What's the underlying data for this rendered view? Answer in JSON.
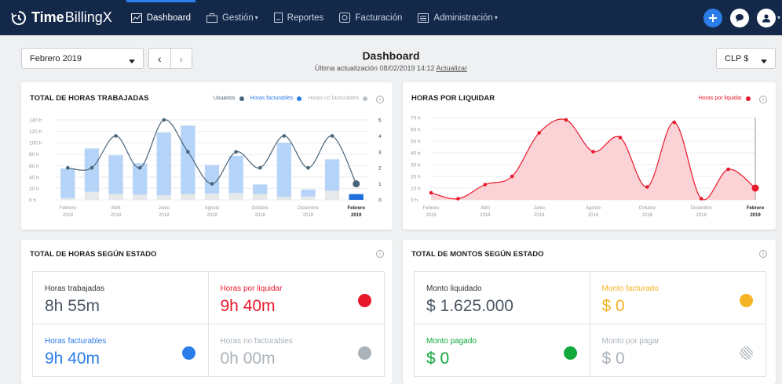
{
  "nav": {
    "brand_bold": "Time",
    "brand_rest": "BillingX",
    "items": [
      {
        "label": "Dashboard"
      },
      {
        "label": "Gestión",
        "caret": "▾"
      },
      {
        "label": "Reportes"
      },
      {
        "label": "Facturación"
      },
      {
        "label": "Administración",
        "caret": "▾"
      }
    ]
  },
  "toolbar": {
    "period": "Febrero 2019",
    "prev": "‹",
    "next": "›",
    "currency": "CLP $",
    "title": "Dashboard",
    "subtitle_prefix": "Última actualización 08/02/2019 14:12",
    "refresh": "Actualizar"
  },
  "card1": {
    "title": "TOTAL DE HORAS TRABAJADAS",
    "legend": [
      {
        "label": "Usuarios",
        "color": "#4a6578"
      },
      {
        "label": "Horas facturables",
        "color": "#2b7de9"
      },
      {
        "label": "Horas no facturables",
        "color": "#bcc3c9"
      }
    ]
  },
  "card2": {
    "title": "HORAS POR LIQUIDAR",
    "legend": [
      {
        "label": "Horas por liquidar",
        "color": "#e8192c"
      }
    ]
  },
  "card3": {
    "title": "TOTAL DE HORAS SEGÚN ESTADO",
    "cells": [
      {
        "label": "Horas trabajadas",
        "value": "8h 55m",
        "label_color": "#333",
        "value_color": "#4a5563",
        "dot": ""
      },
      {
        "label": "Horas por liquidar",
        "value": "9h 40m",
        "label_color": "#e8192c",
        "value_color": "#e8192c",
        "dot": "#e8192c"
      },
      {
        "label": "Horas facturables",
        "value": "9h 40m",
        "label_color": "#2b7de9",
        "value_color": "#2b7de9",
        "dot": "#2b7de9"
      },
      {
        "label": "Horas no facturables",
        "value": "0h 00m",
        "label_color": "#aab2ba",
        "value_color": "#aab2ba",
        "dot": "#aab2ba"
      }
    ]
  },
  "card4": {
    "title": "TOTAL DE MONTOS SEGÚN ESTADO",
    "cells": [
      {
        "label": "Monto liquidado",
        "value": "$ 1.625.000",
        "label_color": "#333",
        "value_color": "#4a5563",
        "dot": ""
      },
      {
        "label": "Monto facturado",
        "value": "$ 0",
        "label_color": "#f4b423",
        "value_color": "#f4b423",
        "dot": "#f4b423"
      },
      {
        "label": "Monto pagado",
        "value": "$ 0",
        "label_color": "#11a83c",
        "value_color": "#11a83c",
        "dot": "#11a83c"
      },
      {
        "label": "Monto por pagar",
        "value": "$ 0",
        "label_color": "#aab2ba",
        "value_color": "#aab2ba",
        "dot": "hatch"
      }
    ]
  },
  "info_icon": "i",
  "chart_data": [
    {
      "type": "bar",
      "title": "TOTAL DE HORAS TRABAJADAS",
      "yticks": [
        "0 h",
        "20 h",
        "40 h",
        "60 h",
        "80 h",
        "100 h",
        "120 h",
        "140 h"
      ],
      "y2ticks": [
        "0",
        "1",
        "2",
        "3",
        "4",
        "5"
      ],
      "ylim": [
        0,
        140
      ],
      "y2lim": [
        0,
        5
      ],
      "grid": true,
      "legend_position": "top-right",
      "x_ticks": [
        {
          "m": "Febrero",
          "y": "2018",
          "i": 0
        },
        {
          "m": "Abril",
          "y": "2018",
          "i": 2
        },
        {
          "m": "Junio",
          "y": "2018",
          "i": 4
        },
        {
          "m": "Agosto",
          "y": "2018",
          "i": 6
        },
        {
          "m": "Octubre",
          "y": "2018",
          "i": 8
        },
        {
          "m": "Diciembre",
          "y": "2018",
          "i": 10
        },
        {
          "m": "Febrero",
          "y": "2019",
          "i": 12
        }
      ],
      "series": [
        {
          "name": "Horas facturables",
          "values": [
            52,
            76,
            68,
            55,
            110,
            120,
            50,
            65,
            17,
            95,
            12,
            55,
            10
          ]
        },
        {
          "name": "Horas no facturables",
          "values": [
            3,
            14,
            10,
            9,
            8,
            10,
            11,
            12,
            10,
            5,
            6,
            16,
            0
          ]
        },
        {
          "name": "Usuarios",
          "values": [
            2,
            2,
            4,
            2,
            5,
            3,
            1,
            3,
            2,
            4,
            2,
            4,
            1
          ]
        }
      ]
    },
    {
      "type": "area",
      "title": "HORAS POR LIQUIDAR",
      "yticks": [
        "0 h",
        "10 h",
        "20 h",
        "30 h",
        "40 h",
        "50 h",
        "60 h",
        "70 h"
      ],
      "ylim": [
        0,
        70
      ],
      "grid": true,
      "legend_position": "top-right",
      "x_ticks": [
        {
          "m": "Febrero",
          "y": "2018",
          "i": 0
        },
        {
          "m": "Abril",
          "y": "2018",
          "i": 2
        },
        {
          "m": "Junio",
          "y": "2018",
          "i": 4
        },
        {
          "m": "Agosto",
          "y": "2018",
          "i": 6
        },
        {
          "m": "Octubre",
          "y": "2018",
          "i": 8
        },
        {
          "m": "Diciembre",
          "y": "2018",
          "i": 10
        },
        {
          "m": "Febrero",
          "y": "2019",
          "i": 12
        }
      ],
      "series": [
        {
          "name": "Horas por liquidar",
          "values": [
            6,
            1,
            13,
            20,
            57,
            68,
            41,
            53,
            11,
            66,
            1,
            26,
            10
          ]
        }
      ]
    }
  ]
}
